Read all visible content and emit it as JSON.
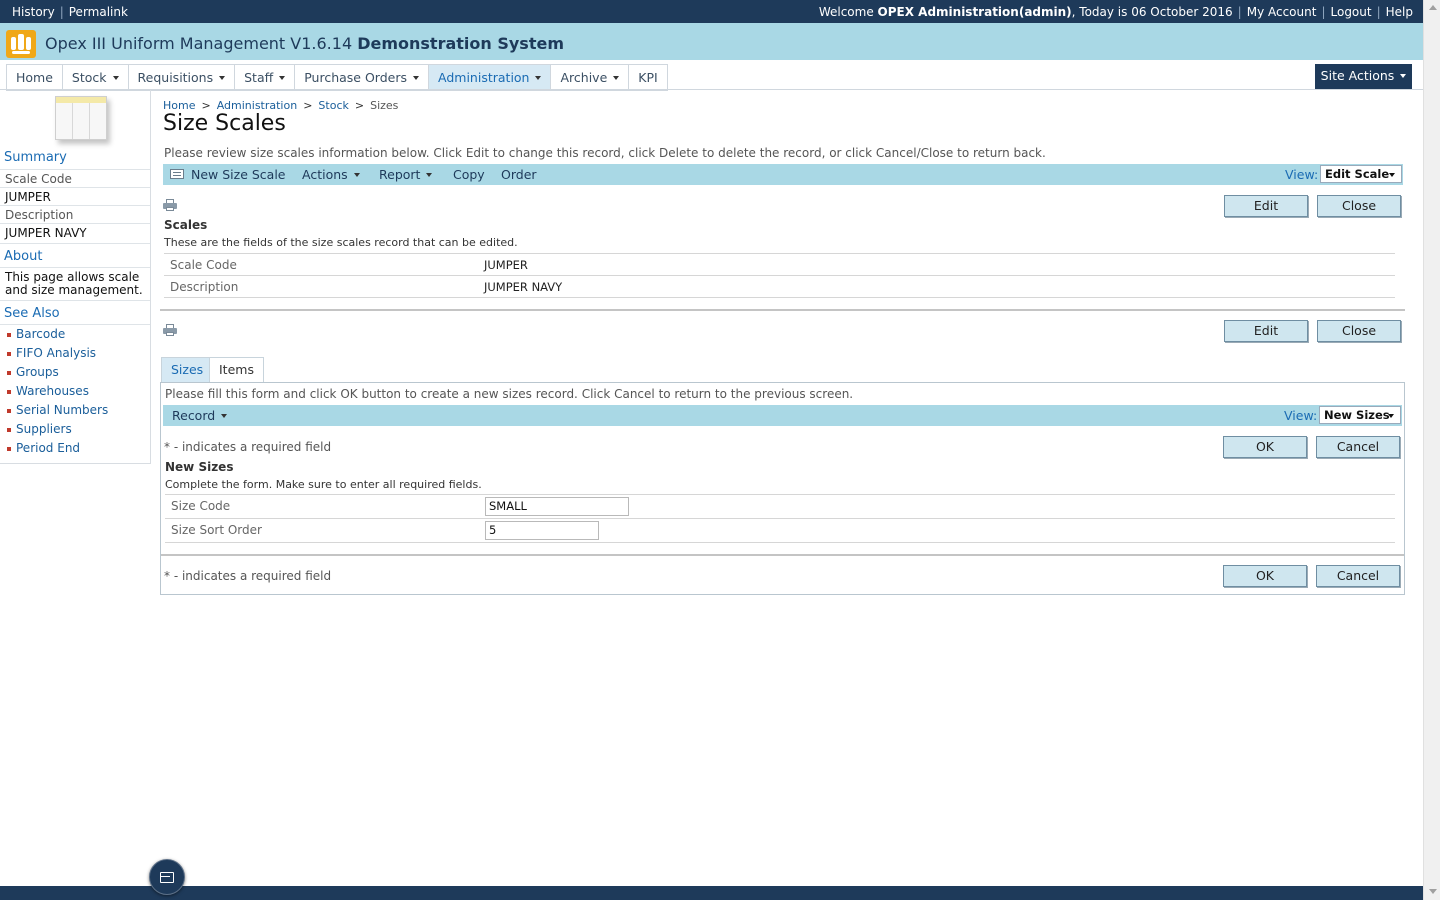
{
  "topbar": {
    "history": "History",
    "permalink": "Permalink",
    "welcome_prefix": "Welcome",
    "user": "OPEX Administration(admin)",
    "today": ", Today is 06 October 2016",
    "my_account": "My Account",
    "logout": "Logout",
    "help": "Help"
  },
  "app": {
    "title_plain": "Opex III Uniform Management V1.6.14",
    "title_bold": "Demonstration System"
  },
  "nav": {
    "home": "Home",
    "stock": "Stock",
    "requisitions": "Requisitions",
    "staff": "Staff",
    "purchase_orders": "Purchase Orders",
    "administration": "Administration",
    "archive": "Archive",
    "kpi": "KPI",
    "site_actions": "Site Actions"
  },
  "left_nav": {
    "summary_heading": "Summary",
    "scale_code_label": "Scale Code",
    "scale_code_value": "JUMPER",
    "description_label": "Description",
    "description_value": "JUMPER NAVY",
    "about_heading": "About",
    "about_line1": "This page allows scale",
    "about_line2": "and size management.",
    "see_also_heading": "See Also",
    "see_also": [
      "Barcode",
      "FIFO Analysis",
      "Groups",
      "Warehouses",
      "Serial Numbers",
      "Suppliers",
      "Period End"
    ]
  },
  "breadcrumb": {
    "home": "Home",
    "administration": "Administration",
    "stock": "Stock",
    "current": "Sizes"
  },
  "page_title": "Size Scales",
  "review_text": "Please review size scales information below. Click Edit to change this record, click Delete to delete the record, or click Cancel/Close to return back.",
  "toolbar1": {
    "new_size_scale": "New Size Scale",
    "actions": "Actions",
    "report": "Report",
    "copy": "Copy",
    "order": "Order",
    "view_label": "View:",
    "view_value": "Edit Scale"
  },
  "buttons": {
    "edit": "Edit",
    "close": "Close",
    "ok": "OK",
    "cancel": "Cancel"
  },
  "scales_section": {
    "title": "Scales",
    "description": "These are the fields of the size scales record that can be edited.",
    "fields": [
      {
        "label": "Scale Code",
        "value": "JUMPER"
      },
      {
        "label": "Description",
        "value": "JUMPER NAVY"
      }
    ]
  },
  "tabs": {
    "sizes": "Sizes",
    "items": "Items"
  },
  "sizes_panel": {
    "instructions": "Please fill this form and click OK button to create a new sizes record. Click Cancel to return to the previous screen.",
    "record_menu": "Record",
    "view_label": "View:",
    "view_value": "New Sizes",
    "required_note": "* - indicates a required field",
    "title": "New Sizes",
    "description": "Complete the form. Make sure to enter all required fields.",
    "size_code_label": "Size Code",
    "size_code_value": "SMALL",
    "sort_order_label": "Size Sort Order",
    "sort_order_value": "5"
  }
}
